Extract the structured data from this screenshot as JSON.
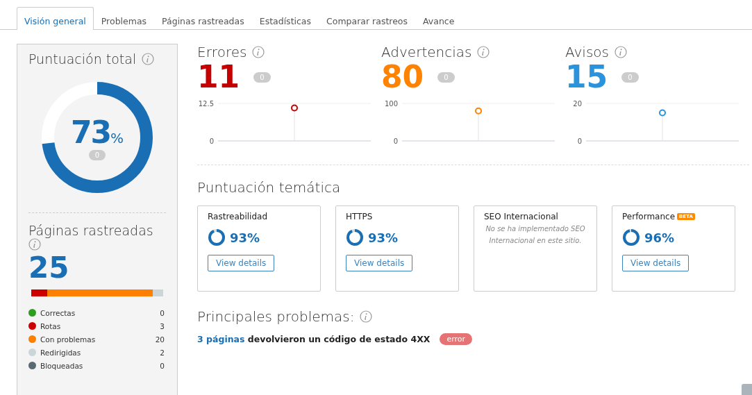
{
  "tabs": [
    {
      "label": "Visión general",
      "selected": true
    },
    {
      "label": "Problemas",
      "selected": false
    },
    {
      "label": "Páginas rastreadas",
      "selected": false
    },
    {
      "label": "Estadísticas",
      "selected": false
    },
    {
      "label": "Comparar rastreos",
      "selected": false
    },
    {
      "label": "Avance",
      "selected": false
    }
  ],
  "total_score": {
    "title": "Puntuación total",
    "value": "73",
    "unit": "%",
    "level": 0.73,
    "delta": "0"
  },
  "crawled_pages": {
    "title": "Páginas rastreadas",
    "count": "25",
    "legend": [
      {
        "label": "Correctas",
        "count": "0",
        "color": "#2ca01c"
      },
      {
        "label": "Rotas",
        "count": "3",
        "color": "#cc0000"
      },
      {
        "label": "Con problemas",
        "count": "20",
        "color": "#ff8000"
      },
      {
        "label": "Redirigidas",
        "count": "2",
        "color": "#ccd6d9"
      },
      {
        "label": "Bloqueadas",
        "count": "0",
        "color": "#5a6a72"
      }
    ]
  },
  "metrics": [
    {
      "title": "Errores",
      "value": "11",
      "delta": "0",
      "color": "#c40000",
      "chart_data": {
        "type": "scatter",
        "ylim": [
          0,
          12.5
        ],
        "yticks": [
          0,
          12.5
        ],
        "values": [
          11
        ]
      }
    },
    {
      "title": "Advertencias",
      "value": "80",
      "delta": "0",
      "color": "#ff8200",
      "chart_data": {
        "type": "scatter",
        "ylim": [
          0,
          100
        ],
        "yticks": [
          0,
          100
        ],
        "values": [
          80
        ]
      }
    },
    {
      "title": "Avisos",
      "value": "15",
      "delta": "0",
      "color": "#2b93dc",
      "chart_data": {
        "type": "scatter",
        "ylim": [
          0,
          20
        ],
        "yticks": [
          0,
          20
        ],
        "values": [
          15
        ]
      }
    }
  ],
  "thematic": {
    "title": "Puntuación temática",
    "cards": [
      {
        "kind": "score",
        "title": "Rastreabilidad",
        "score": "93%",
        "level": 0.93,
        "button": "View details"
      },
      {
        "kind": "score",
        "title": "HTTPS",
        "score": "93%",
        "level": 0.93,
        "button": "View details"
      },
      {
        "kind": "message",
        "title": "SEO Internacional",
        "message": "No se ha implementado SEO Internacional en este sitio."
      },
      {
        "kind": "score",
        "title": "Performance",
        "badge": "BETA",
        "score": "96%",
        "level": 0.96,
        "button": "View details"
      }
    ]
  },
  "top_issues": {
    "title": "Principales problemas:",
    "items": [
      {
        "link": "3 páginas",
        "text": "devolvieron un código de estado 4XX",
        "severity": "error"
      }
    ]
  }
}
